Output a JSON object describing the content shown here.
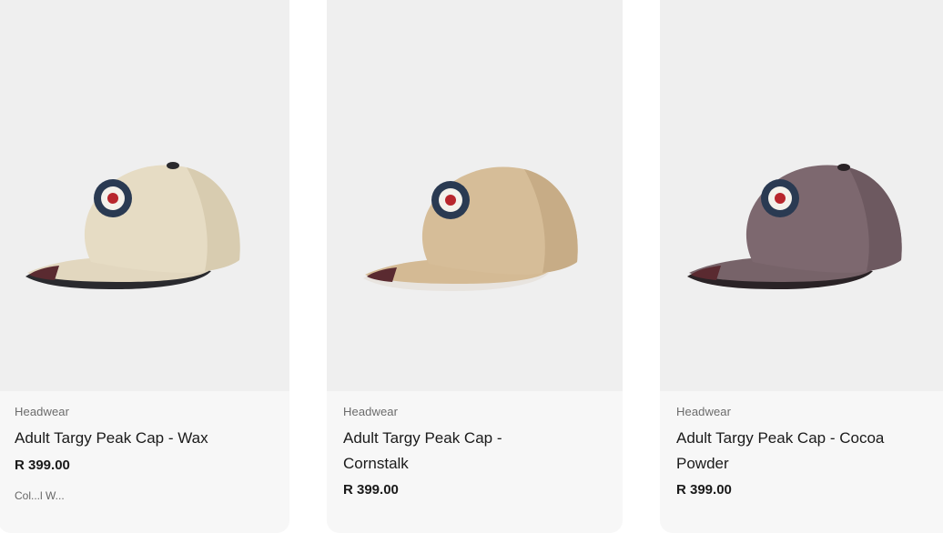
{
  "products": [
    {
      "category": "Headwear",
      "title": "Adult Targy Peak Cap - Wax",
      "price": "R 399.00",
      "colour_label": "Col...l W...",
      "colors": {
        "crown": "#e6dcc4",
        "crown_shade": "#d8ccb0",
        "brim": "#e2d7bf",
        "underbrim": "#2a2a2e"
      }
    },
    {
      "category": "Headwear",
      "title": "Adult Targy Peak Cap - Cornstalk",
      "price": "R 399.00",
      "colors": {
        "crown": "#d6bd98",
        "crown_shade": "#c7ac86",
        "brim": "#d4ba94",
        "underbrim": "#e8e4df"
      }
    },
    {
      "category": "Headwear",
      "title": "Adult Targy Peak Cap - Cocoa Powder",
      "price": "R 399.00",
      "colors": {
        "crown": "#7d686f",
        "crown_shade": "#6d5960",
        "brim": "#776369",
        "underbrim": "#2a2326"
      }
    }
  ],
  "badge_colors": {
    "outer": "#2a3a52",
    "middle": "#f4f1ea",
    "inner": "#b8262c"
  }
}
